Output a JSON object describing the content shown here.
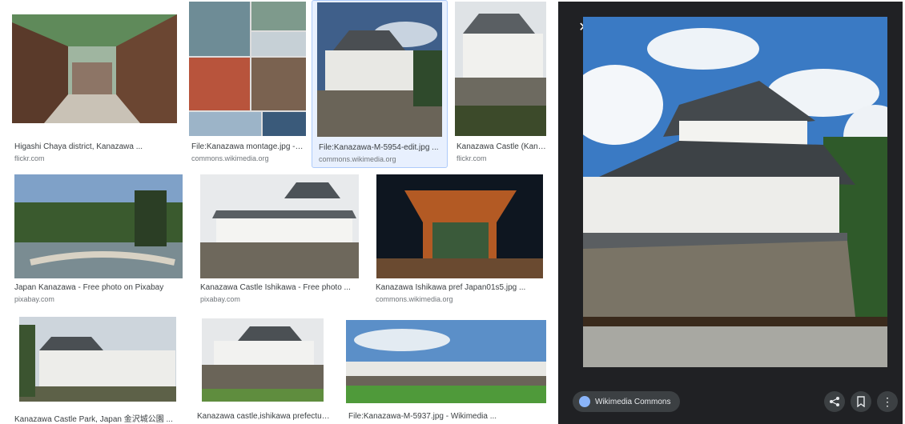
{
  "results": [
    {
      "title": "Higashi Chaya district, Kanazawa ...",
      "source": "flickr.com"
    },
    {
      "title": "File:Kanazawa montage.jpg - Wi...",
      "source": "commons.wikimedia.org"
    },
    {
      "title": "File:Kanazawa-M-5954-edit.jpg ...",
      "source": "commons.wikimedia.org"
    },
    {
      "title": "Kanazawa Castle (Kanaz...",
      "source": "flickr.com"
    },
    {
      "title": "Japan Kanazawa - Free photo on Pixabay",
      "source": "pixabay.com"
    },
    {
      "title": "Kanazawa Castle Ishikawa - Free photo ...",
      "source": "pixabay.com"
    },
    {
      "title": "Kanazawa Ishikawa pref Japan01s5.jpg ...",
      "source": "commons.wikimedia.org"
    },
    {
      "title": "Kanazawa Castle Park, Japan 金沢城公園 ...",
      "source": ""
    },
    {
      "title": "Kanazawa castle,ishikawa prefecture ...",
      "source": ""
    },
    {
      "title": "File:Kanazawa-M-5937.jpg - Wikimedia ...",
      "source": ""
    }
  ],
  "preview": {
    "source_label": "Wikimedia Commons",
    "icons": {
      "close": "close-icon",
      "prev": "chevron-left-icon",
      "next": "chevron-right-icon",
      "share": "share-icon",
      "save": "bookmark-icon",
      "more": "more-vert-icon",
      "globe": "globe-icon"
    }
  }
}
